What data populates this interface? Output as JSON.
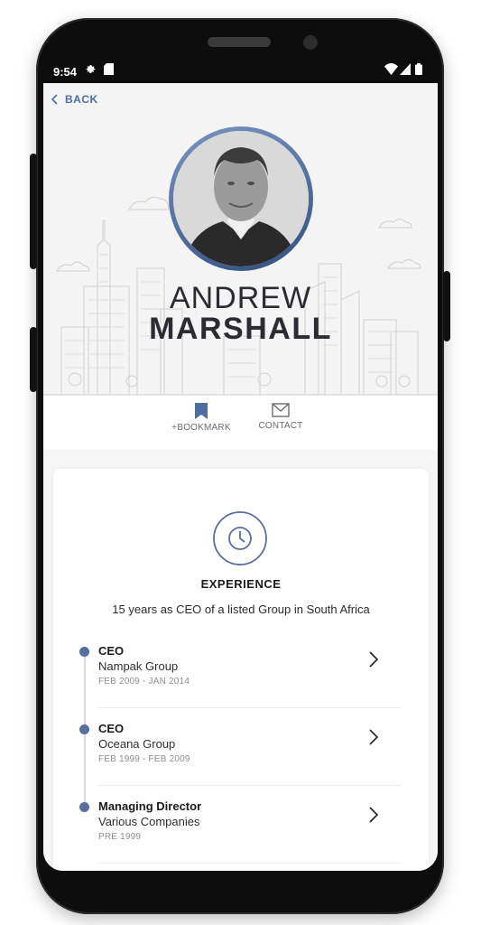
{
  "status_bar": {
    "time": "9:54",
    "icons": [
      "gear-icon",
      "sd-card-icon",
      "wifi-icon",
      "signal-icon",
      "battery-icon"
    ]
  },
  "nav": {
    "back_label": "BACK"
  },
  "profile": {
    "first_name": "ANDREW",
    "last_name": "MARSHALL"
  },
  "actions": [
    {
      "label": "+BOOKMARK",
      "icon": "bookmark-icon"
    },
    {
      "label": "CONTACT",
      "icon": "envelope-icon"
    }
  ],
  "experience": {
    "title": "EXPERIENCE",
    "summary": "15 years as CEO of a listed Group in South Africa",
    "items": [
      {
        "role": "CEO",
        "company": "Nampak Group",
        "dates": "FEB 2009 - JAN 2014"
      },
      {
        "role": "CEO",
        "company": "Oceana Group",
        "dates": "FEB 1999 - FEB 2009"
      },
      {
        "role": "Managing Director",
        "company": "Various Companies",
        "dates": "PRE 1999"
      }
    ]
  },
  "colors": {
    "accent": "#4d6ea3",
    "timeline_dot": "#566f9e",
    "text": "#2b2b33"
  }
}
